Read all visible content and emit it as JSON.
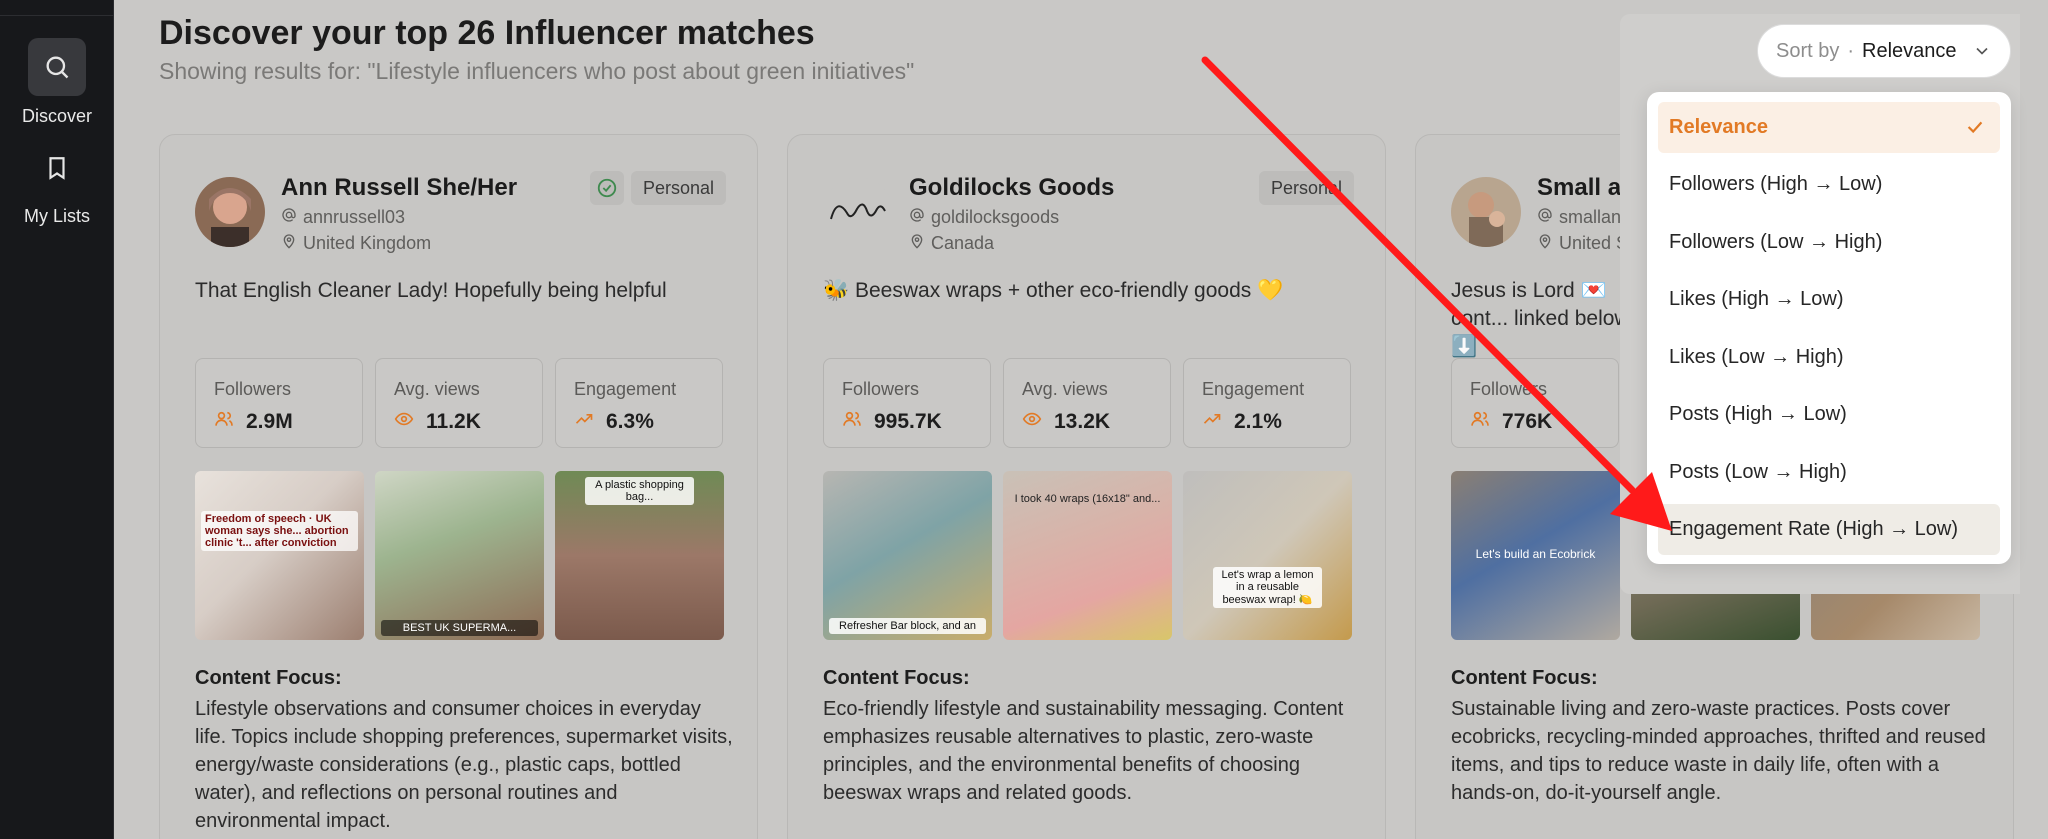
{
  "sidebar": {
    "items": [
      {
        "label": "Discover",
        "icon": "search-icon",
        "active": true
      },
      {
        "label": "My Lists",
        "icon": "bookmark-icon",
        "active": false
      }
    ]
  },
  "header": {
    "title": "Discover your top 26 Influencer matches",
    "subtitle": "Showing results for: \"Lifestyle influencers who post about green initiatives\""
  },
  "sort": {
    "label": "Sort by",
    "separator": "·",
    "value": "Relevance",
    "options": [
      "Relevance",
      "Followers (High → Low)",
      "Followers (Low → High)",
      "Likes (High → Low)",
      "Likes (Low → High)",
      "Posts (High → Low)",
      "Posts (Low → High)",
      "Engagement Rate (High → Low)"
    ],
    "selected_index": 0,
    "hovered_index": 7
  },
  "stat_labels": {
    "followers": "Followers",
    "views": "Avg. views",
    "engagement": "Engagement"
  },
  "content_focus_label": "Content Focus:",
  "cards": [
    {
      "name": "Ann Russell She/Her",
      "handle": "annrussell03",
      "location": "United Kingdom",
      "badge": "Personal",
      "verified": true,
      "bio": "That English Cleaner Lady! Hopefully being helpful",
      "followers": "2.9M",
      "views": "11.2K",
      "engagement": "6.3%",
      "thumb_captions": [
        "Freedom of speech · UK woman says she... abortion clinic 't... after conviction",
        "BEST UK SUPERMA...",
        "A plastic shopping bag..."
      ],
      "content_focus": "Lifestyle observations and consumer choices in everyday life. Topics include shopping preferences, supermarket visits, energy/waste considerations (e.g., plastic caps, bottled water), and reflections on personal routines and environmental impact."
    },
    {
      "name": "Goldilocks Goods",
      "handle": "goldilocksgoods",
      "location": "Canada",
      "badge": "Personal",
      "verified": false,
      "bio": "🐝 Beeswax wraps + other eco-friendly goods 💛",
      "followers": "995.7K",
      "views": "13.2K",
      "engagement": "2.1%",
      "thumb_captions": [
        "Refresher Bar block, and an",
        "I took 40 wraps (16x18\" and...",
        "Let's wrap a lemon in a reusable beeswax wrap! 🍋"
      ],
      "content_focus": "Eco-friendly lifestyle and sustainability messaging. Content emphasizes reusable alternatives to plastic, zero-waste principles, and the environmental benefits of choosing beeswax wraps and related goods."
    },
    {
      "name": "Small and",
      "handle": "smallandfr",
      "location": "United Stat",
      "badge": "",
      "verified": false,
      "bio": "Jesus is Lord 💌 cont... linked below ⬇️",
      "followers": "776K",
      "views": "",
      "engagement": "",
      "thumb_captions": [
        "Let's build an Ecobrick",
        "",
        ""
      ],
      "content_focus": "Sustainable living and zero-waste practices. Posts cover ecobricks, recycling-minded approaches, thrifted and reused items, and tips to reduce waste in daily life, often with a hands-on, do-it-yourself angle."
    }
  ],
  "colors": {
    "accent": "#e27a25",
    "sidebar_bg": "#17181b",
    "overlay_bg": "#c9c8c6",
    "arrow": "#ff1a1a"
  }
}
